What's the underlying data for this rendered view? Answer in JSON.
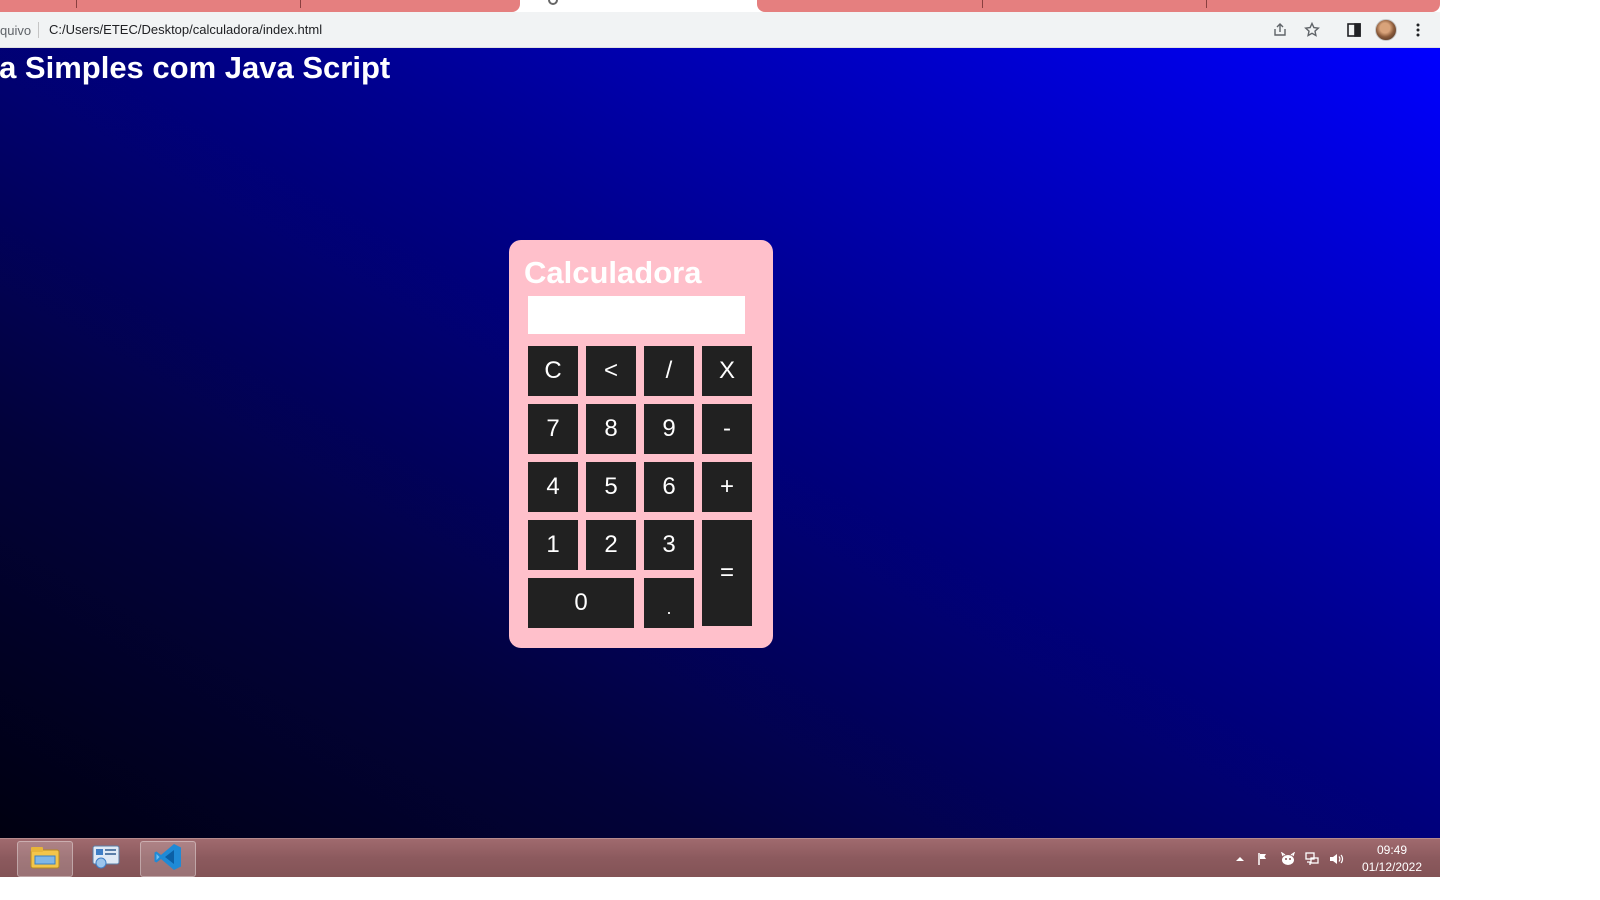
{
  "browser": {
    "address_prefix": "quivo",
    "url": "C:/Users/ETEC/Desktop/calculadora/index.html",
    "icons": [
      "share-icon",
      "star-icon",
      "side-panel-icon",
      "avatar",
      "menu-kebab-icon"
    ]
  },
  "page": {
    "heading": "ra Simples com Java Script"
  },
  "calculator": {
    "title": "Calculadora",
    "display_value": "",
    "keys": {
      "clear": "C",
      "backspace": "<",
      "divide": "/",
      "multiply": "X",
      "seven": "7",
      "eight": "8",
      "nine": "9",
      "minus": "-",
      "four": "4",
      "five": "5",
      "six": "6",
      "plus": "+",
      "one": "1",
      "two": "2",
      "three": "3",
      "equals": "=",
      "zero": "0",
      "dot": "."
    }
  },
  "taskbar": {
    "apps": [
      "file-explorer-icon",
      "control-panel-icon",
      "vscode-icon"
    ],
    "time": "09:49",
    "date": "01/12/2022"
  },
  "colors": {
    "calculator_bg": "#ffc0cb",
    "key_bg": "#212121",
    "page_gradient_start": "#000010",
    "page_gradient_end": "#0000ff",
    "taskbar": "#8c5a5e",
    "tab_color": "#e57f7f"
  }
}
